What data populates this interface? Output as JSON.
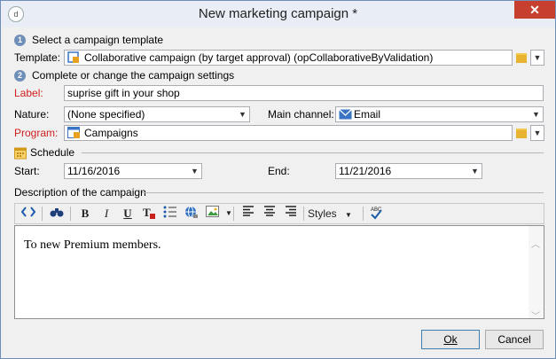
{
  "window": {
    "title": "New marketing campaign *",
    "close_glyph": "✕",
    "app_icon_glyph": "d"
  },
  "step1": {
    "number": "1",
    "label": "Select a campaign template"
  },
  "template": {
    "label": "Template:",
    "value": "Collaborative campaign (by target approval) (opCollaborativeByValidation)"
  },
  "step2": {
    "number": "2",
    "label": "Complete or change the campaign settings"
  },
  "label_field": {
    "label": "Label:",
    "value": "suprise gift in your shop"
  },
  "nature": {
    "label": "Nature:",
    "value": "(None specified)"
  },
  "main_channel": {
    "label": "Main channel:",
    "value": "Email"
  },
  "program": {
    "label": "Program:",
    "value": "Campaigns"
  },
  "schedule": {
    "label": "Schedule",
    "start_label": "Start:",
    "start_value": "11/16/2016",
    "end_label": "End:",
    "end_value": "11/21/2016"
  },
  "description": {
    "label": "Description of the campaign",
    "text": "To new Premium members."
  },
  "toolbar": {
    "bold": "B",
    "italic": "I",
    "underline": "U",
    "styles": "Styles"
  },
  "buttons": {
    "ok": "Ok",
    "cancel": "Cancel"
  },
  "colors": {
    "accent": "#6f8fb8",
    "required_label": "#d02020",
    "close": "#c7402f"
  }
}
